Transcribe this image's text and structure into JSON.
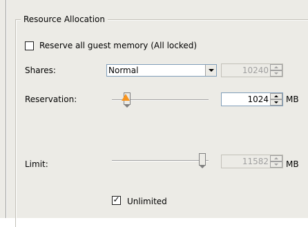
{
  "group": {
    "title": "Resource Allocation"
  },
  "reserve_memory": {
    "label": "Reserve all guest memory (All locked)",
    "checked": false
  },
  "shares": {
    "label": "Shares:",
    "selected": "Normal",
    "value": "10240"
  },
  "reservation": {
    "label": "Reservation:",
    "value": "1024",
    "unit": "MB",
    "slider_fraction": 0.13
  },
  "limit": {
    "label": "Limit:",
    "value": "11582",
    "unit": "MB",
    "slider_fraction": 0.97
  },
  "unlimited": {
    "label": "Unlimited",
    "checked": true
  },
  "colors": {
    "warning": "#f7941d",
    "panel": "#ecebe6"
  },
  "icons": {
    "warning": "warning-triangle-icon",
    "dropdown": "chevron-down-icon"
  }
}
